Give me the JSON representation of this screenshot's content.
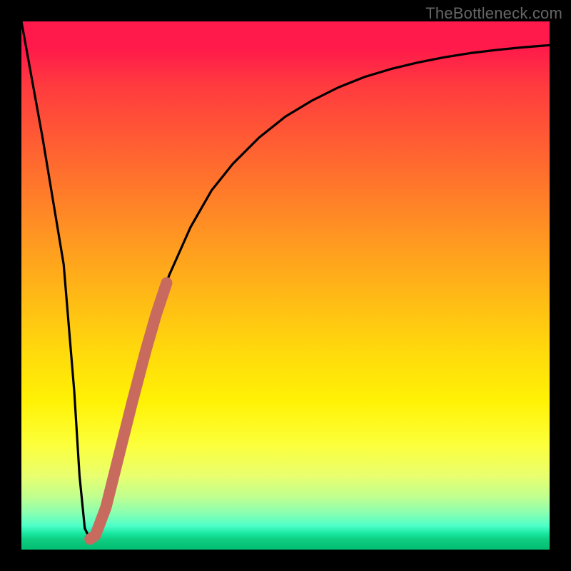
{
  "watermark": "TheBottleneck.com",
  "chart_data": {
    "type": "line",
    "title": "",
    "xlabel": "",
    "ylabel": "",
    "xlim": [
      0,
      100
    ],
    "ylim": [
      0,
      100
    ],
    "series": [
      {
        "name": "bottleneck-curve",
        "x": [
          0,
          2,
          4,
          6,
          8,
          10,
          11,
          12,
          13,
          14,
          15,
          16,
          18,
          20,
          22,
          25,
          28,
          32,
          36,
          40,
          45,
          50,
          55,
          60,
          65,
          70,
          75,
          80,
          85,
          90,
          95,
          100
        ],
        "y": [
          100,
          89,
          78,
          66,
          54,
          30,
          14,
          4,
          2,
          3,
          6,
          10,
          18,
          26,
          34,
          44,
          52,
          61,
          68,
          73,
          78,
          82,
          85,
          87.5,
          89.5,
          91,
          92.2,
          93.2,
          94,
          94.6,
          95.1,
          95.5
        ]
      }
    ],
    "highlight_segment": {
      "description": "salmon thick overlay along rising branch",
      "x": [
        13.0,
        14.0,
        16.0,
        18.5,
        21.0,
        23.5,
        25.5,
        27.5
      ],
      "y": [
        2.0,
        2.7,
        8.0,
        18.0,
        28.0,
        37.5,
        44.5,
        50.5
      ]
    },
    "background_gradient": {
      "top_color": "#ff1a4b",
      "bottom_color": "#04bf74",
      "mid_colors": [
        "#ff7a2a",
        "#ffd80c",
        "#fcff3a",
        "#8affb0"
      ]
    }
  }
}
